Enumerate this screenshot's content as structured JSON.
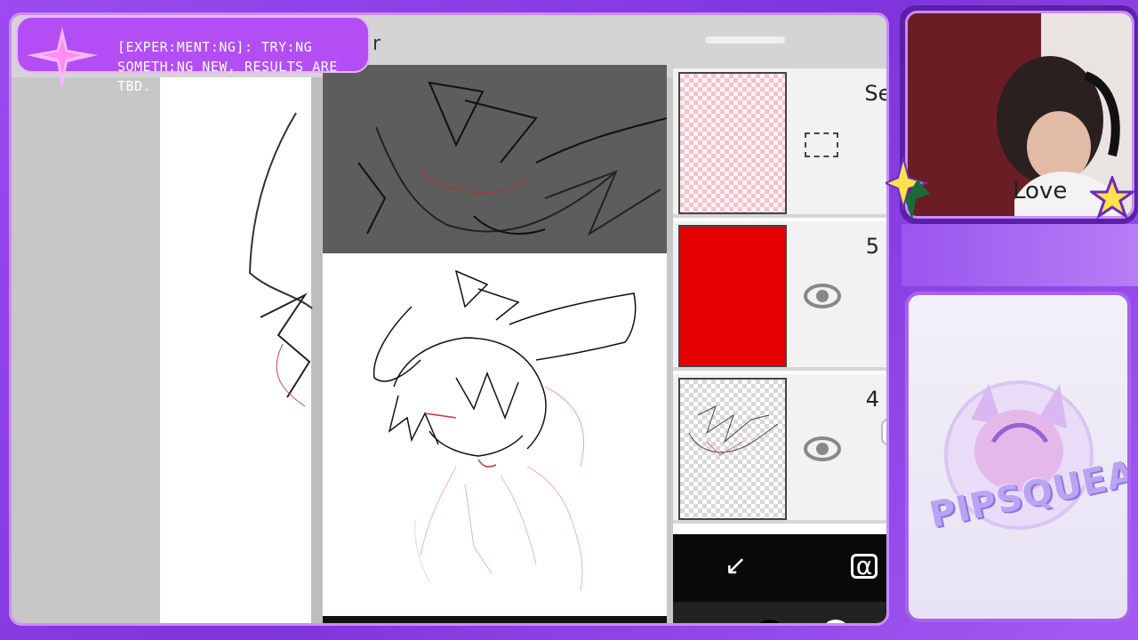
{
  "banner": {
    "text": "[EXPER:MENT:NG]: TRY:NG SOMETH:NG NEW, RESULTS ARE TBD."
  },
  "app": {
    "title_fragment": "r"
  },
  "layers": [
    {
      "name": "Sel",
      "thumb": "pink-checker",
      "icon": "selection-icon"
    },
    {
      "name": "5",
      "thumb": "red-fill",
      "icon": "eye-icon"
    },
    {
      "name": "4",
      "thumb": "sketch",
      "icon": "eye-icon"
    }
  ],
  "toolbar": {
    "merge_down_icon": "arrow-down-left-icon",
    "alpha_lock_icon": "alpha-lock-icon",
    "merge_glyph": "↙",
    "alpha_glyph": "α"
  },
  "webcam": {
    "shirt_text": "Love"
  },
  "logo": {
    "text": "PIPSQUEAK"
  },
  "colors": {
    "frame": "#8e3fe0",
    "banner": "#b24ef3",
    "layer_red": "#e40000",
    "star_yellow": "#ffe14a"
  }
}
